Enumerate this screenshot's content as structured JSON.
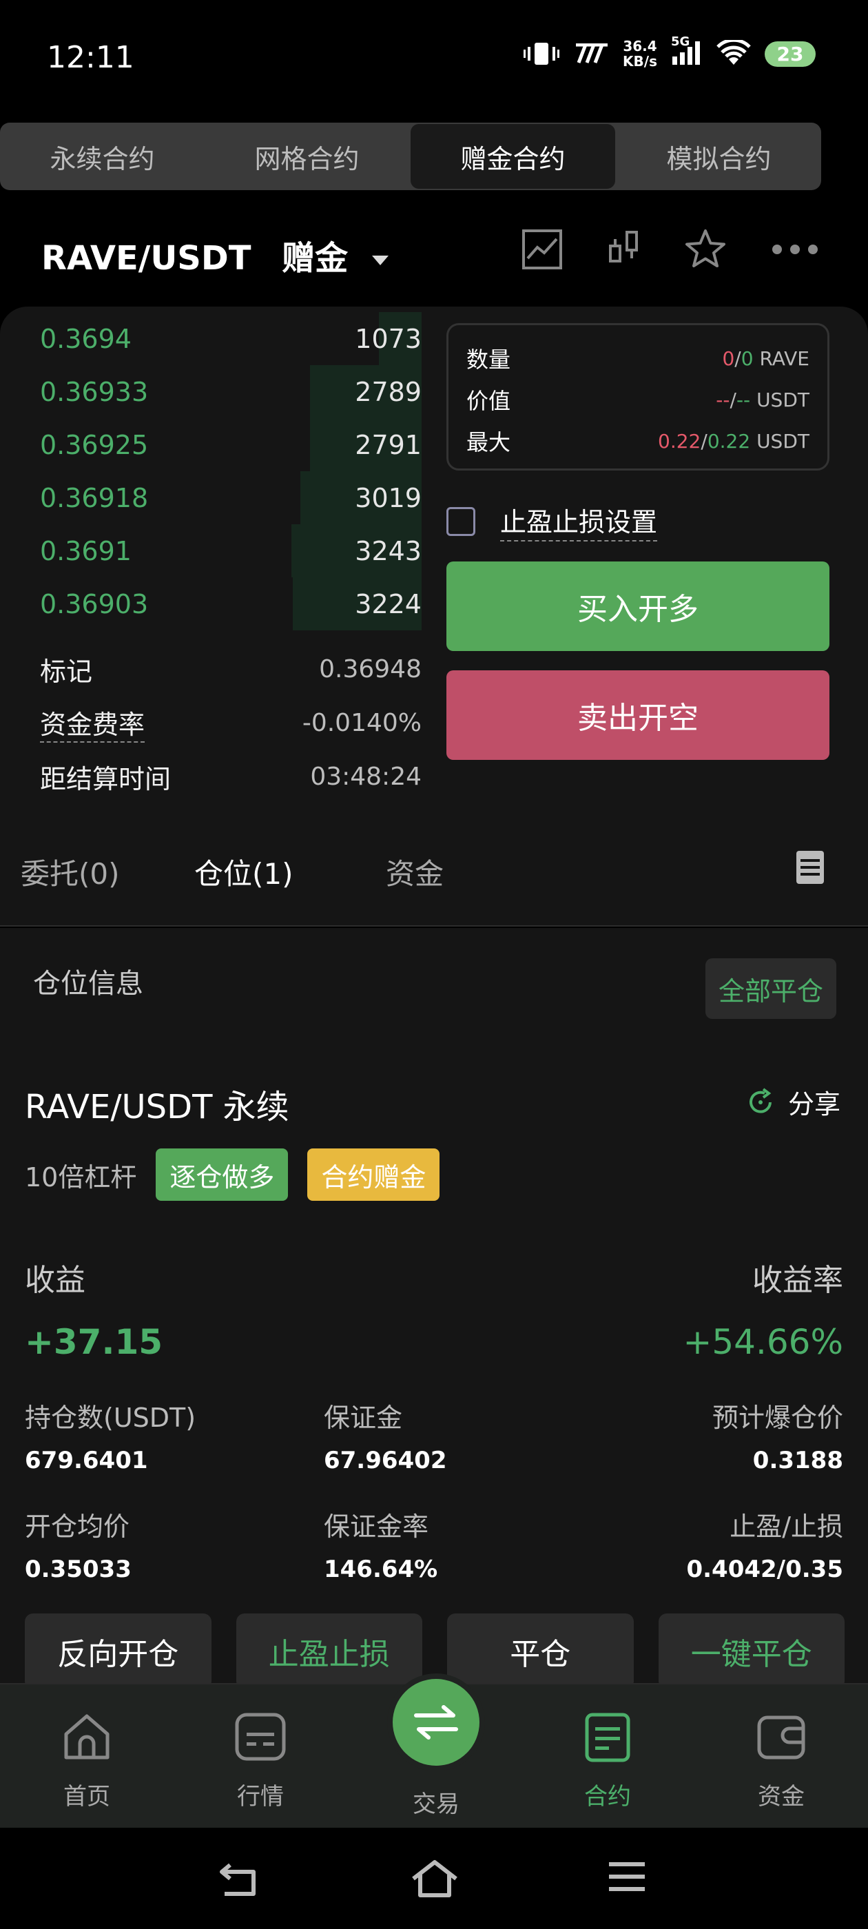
{
  "status_bar": {
    "time": "12:11",
    "net_speed_value": "36.4",
    "net_speed_unit": "KB/s",
    "network": "5G",
    "battery": "23"
  },
  "top_tabs": [
    "永续合约",
    "网格合约",
    "赠金合约",
    "模拟合约"
  ],
  "active_top_tab": 2,
  "pair": {
    "symbol": "RAVE/USDT",
    "tag": "赠金"
  },
  "header_icons": [
    "line-chart-icon",
    "candlestick-icon",
    "star-icon",
    "more-icon"
  ],
  "order_book": {
    "asks": [
      {
        "price": "0.3694",
        "qty": "1073",
        "depth": 0.33
      },
      {
        "price": "0.36933",
        "qty": "2789",
        "depth": 0.86
      },
      {
        "price": "0.36925",
        "qty": "2791",
        "depth": 0.86
      },
      {
        "price": "0.36918",
        "qty": "3019",
        "depth": 0.93
      },
      {
        "price": "0.3691",
        "qty": "3243",
        "depth": 1.0
      },
      {
        "price": "0.36903",
        "qty": "3224",
        "depth": 0.99
      }
    ],
    "mark_label": "标记",
    "mark_value": "0.36948",
    "funding_label": "资金费率",
    "funding_value": "-0.0140%",
    "settle_label": "距结算时间",
    "settle_value": "03:48:24"
  },
  "info_box": {
    "qty_label": "数量",
    "qty_a": "0",
    "qty_b": "0",
    "qty_unit": "RAVE",
    "value_label": "价值",
    "value_a": "--",
    "value_b": "--",
    "value_unit": "USDT",
    "max_label": "最大",
    "max_a": "0.22",
    "max_b": "0.22",
    "max_unit": "USDT"
  },
  "tpsl_setting": "止盈止损设置",
  "buttons": {
    "long": "买入开多",
    "short": "卖出开空"
  },
  "section_tabs": [
    "委托(0)",
    "仓位(1)",
    "资金"
  ],
  "active_section_tab": 1,
  "positions": {
    "title": "仓位信息",
    "close_all": "全部平仓",
    "symbol": "RAVE/USDT 永续",
    "share": "分享",
    "leverage": "10倍杠杆",
    "chip_side": "逐仓做多",
    "chip_bonus": "合约赠金",
    "pnl_label": "收益",
    "pnl_value": "+37.15",
    "roe_label": "收益率",
    "roe_value": "+54.66%",
    "size_label": "持仓数(USDT)",
    "size_value": "679.6401",
    "margin_label": "保证金",
    "margin_value": "67.96402",
    "liq_label": "预计爆仓价",
    "liq_value": "0.3188",
    "entry_label": "开仓均价",
    "entry_value": "0.35033",
    "margin_rate_label": "保证金率",
    "margin_rate_value": "146.64%",
    "tpsl_label": "止盈/止损",
    "tpsl_value": "0.4042/0.35",
    "actions": [
      "反向开仓",
      "止盈止损",
      "平仓",
      "一键平仓"
    ]
  },
  "bottom_nav": [
    "首页",
    "行情",
    "交易",
    "合约",
    "资金"
  ],
  "active_bottom_nav": 3,
  "colors": {
    "green": "#4caf6a",
    "red": "#e5596a",
    "yellow": "#e8b93e",
    "bg": "#151515"
  }
}
